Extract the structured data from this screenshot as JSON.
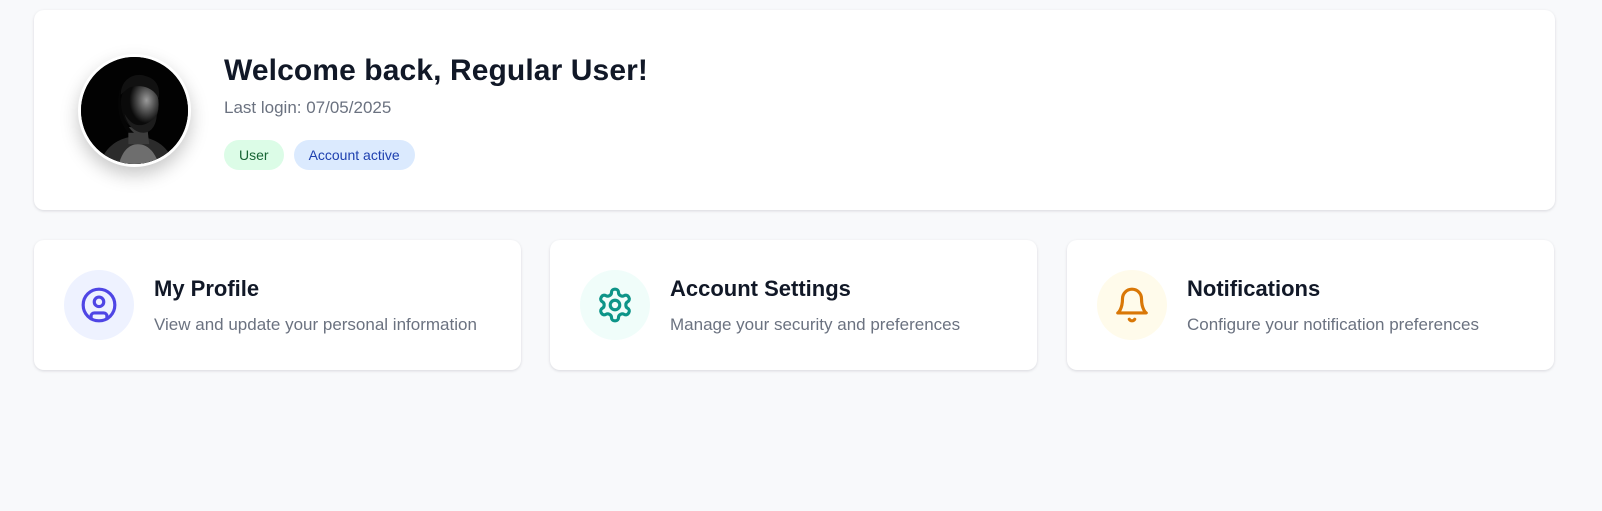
{
  "welcome": {
    "title": "Welcome back, Regular User!",
    "last_login": "Last login: 07/05/2025",
    "badges": {
      "role": "User",
      "status": "Account active"
    }
  },
  "cards": [
    {
      "title": "My Profile",
      "description": "View and update your personal information",
      "icon": "user-circle-icon",
      "icon_color": "#4f46e5",
      "icon_bg": "#eef2ff"
    },
    {
      "title": "Account Settings",
      "description": "Manage your security and preferences",
      "icon": "gear-icon",
      "icon_color": "#0d9488",
      "icon_bg": "#f0fdfa"
    },
    {
      "title": "Notifications",
      "description": "Configure your notification preferences",
      "icon": "bell-icon",
      "icon_color": "#d97706",
      "icon_bg": "#fffbeb"
    }
  ],
  "colors": {
    "page_background": "#f8f9fb",
    "heading": "#111827",
    "muted_text": "#6b7280",
    "role_badge_bg": "#dcfce7",
    "status_badge_bg": "#dbeafe"
  }
}
